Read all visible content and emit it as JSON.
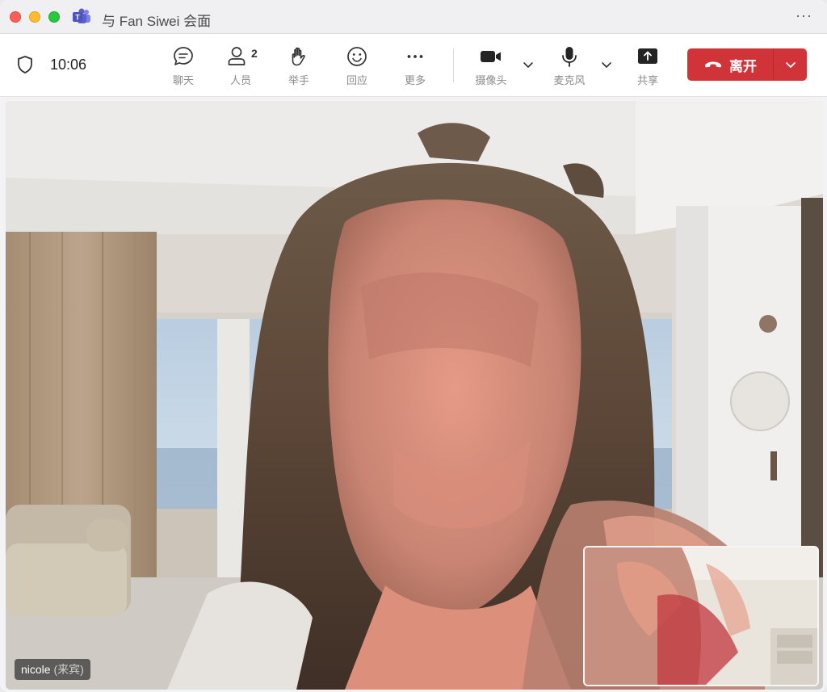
{
  "window": {
    "title": "与 Fan Siwei 会面",
    "more": "···"
  },
  "toolbar": {
    "timer": "10:06",
    "chat_label": "聊天",
    "people_label": "人员",
    "people_count": "2",
    "raise_hand_label": "举手",
    "react_label": "回应",
    "more_label": "更多",
    "camera_label": "摄像头",
    "mic_label": "麦克风",
    "share_label": "共享",
    "leave_label": "离开"
  },
  "stage": {
    "participant_name": "nicole",
    "participant_role": "(来宾)"
  },
  "colors": {
    "leave_red": "#d13438",
    "teams_purple": "#5b5fc7"
  },
  "icons": [
    "teams-logo-icon",
    "shield-icon",
    "chat-icon",
    "people-icon",
    "hand-icon",
    "smile-icon",
    "more-icon",
    "camera-icon",
    "chevron-down-icon",
    "mic-icon",
    "share-icon",
    "phone-hangup-icon"
  ]
}
